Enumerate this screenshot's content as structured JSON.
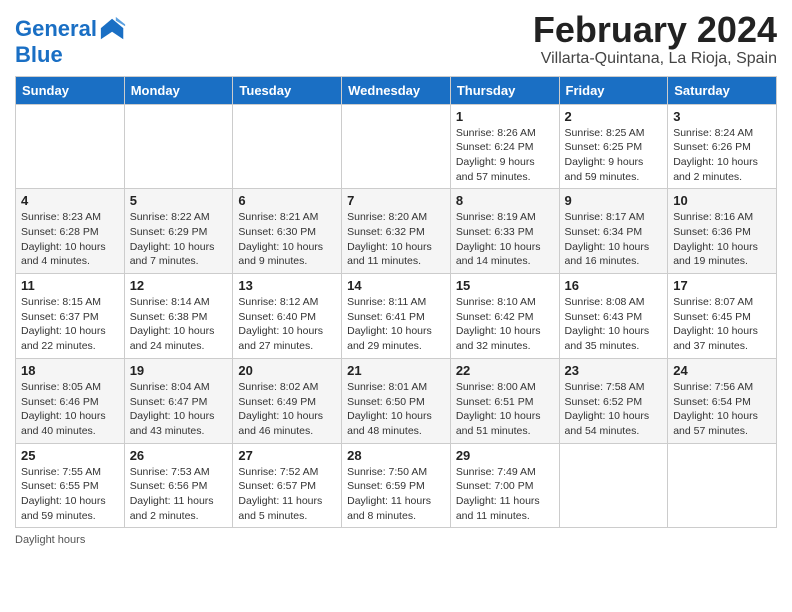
{
  "header": {
    "logo_line1": "General",
    "logo_line2": "Blue",
    "month": "February 2024",
    "location": "Villarta-Quintana, La Rioja, Spain"
  },
  "days_of_week": [
    "Sunday",
    "Monday",
    "Tuesday",
    "Wednesday",
    "Thursday",
    "Friday",
    "Saturday"
  ],
  "weeks": [
    [
      {
        "day": "",
        "info": ""
      },
      {
        "day": "",
        "info": ""
      },
      {
        "day": "",
        "info": ""
      },
      {
        "day": "",
        "info": ""
      },
      {
        "day": "1",
        "info": "Sunrise: 8:26 AM\nSunset: 6:24 PM\nDaylight: 9 hours and 57 minutes."
      },
      {
        "day": "2",
        "info": "Sunrise: 8:25 AM\nSunset: 6:25 PM\nDaylight: 9 hours and 59 minutes."
      },
      {
        "day": "3",
        "info": "Sunrise: 8:24 AM\nSunset: 6:26 PM\nDaylight: 10 hours and 2 minutes."
      }
    ],
    [
      {
        "day": "4",
        "info": "Sunrise: 8:23 AM\nSunset: 6:28 PM\nDaylight: 10 hours and 4 minutes."
      },
      {
        "day": "5",
        "info": "Sunrise: 8:22 AM\nSunset: 6:29 PM\nDaylight: 10 hours and 7 minutes."
      },
      {
        "day": "6",
        "info": "Sunrise: 8:21 AM\nSunset: 6:30 PM\nDaylight: 10 hours and 9 minutes."
      },
      {
        "day": "7",
        "info": "Sunrise: 8:20 AM\nSunset: 6:32 PM\nDaylight: 10 hours and 11 minutes."
      },
      {
        "day": "8",
        "info": "Sunrise: 8:19 AM\nSunset: 6:33 PM\nDaylight: 10 hours and 14 minutes."
      },
      {
        "day": "9",
        "info": "Sunrise: 8:17 AM\nSunset: 6:34 PM\nDaylight: 10 hours and 16 minutes."
      },
      {
        "day": "10",
        "info": "Sunrise: 8:16 AM\nSunset: 6:36 PM\nDaylight: 10 hours and 19 minutes."
      }
    ],
    [
      {
        "day": "11",
        "info": "Sunrise: 8:15 AM\nSunset: 6:37 PM\nDaylight: 10 hours and 22 minutes."
      },
      {
        "day": "12",
        "info": "Sunrise: 8:14 AM\nSunset: 6:38 PM\nDaylight: 10 hours and 24 minutes."
      },
      {
        "day": "13",
        "info": "Sunrise: 8:12 AM\nSunset: 6:40 PM\nDaylight: 10 hours and 27 minutes."
      },
      {
        "day": "14",
        "info": "Sunrise: 8:11 AM\nSunset: 6:41 PM\nDaylight: 10 hours and 29 minutes."
      },
      {
        "day": "15",
        "info": "Sunrise: 8:10 AM\nSunset: 6:42 PM\nDaylight: 10 hours and 32 minutes."
      },
      {
        "day": "16",
        "info": "Sunrise: 8:08 AM\nSunset: 6:43 PM\nDaylight: 10 hours and 35 minutes."
      },
      {
        "day": "17",
        "info": "Sunrise: 8:07 AM\nSunset: 6:45 PM\nDaylight: 10 hours and 37 minutes."
      }
    ],
    [
      {
        "day": "18",
        "info": "Sunrise: 8:05 AM\nSunset: 6:46 PM\nDaylight: 10 hours and 40 minutes."
      },
      {
        "day": "19",
        "info": "Sunrise: 8:04 AM\nSunset: 6:47 PM\nDaylight: 10 hours and 43 minutes."
      },
      {
        "day": "20",
        "info": "Sunrise: 8:02 AM\nSunset: 6:49 PM\nDaylight: 10 hours and 46 minutes."
      },
      {
        "day": "21",
        "info": "Sunrise: 8:01 AM\nSunset: 6:50 PM\nDaylight: 10 hours and 48 minutes."
      },
      {
        "day": "22",
        "info": "Sunrise: 8:00 AM\nSunset: 6:51 PM\nDaylight: 10 hours and 51 minutes."
      },
      {
        "day": "23",
        "info": "Sunrise: 7:58 AM\nSunset: 6:52 PM\nDaylight: 10 hours and 54 minutes."
      },
      {
        "day": "24",
        "info": "Sunrise: 7:56 AM\nSunset: 6:54 PM\nDaylight: 10 hours and 57 minutes."
      }
    ],
    [
      {
        "day": "25",
        "info": "Sunrise: 7:55 AM\nSunset: 6:55 PM\nDaylight: 10 hours and 59 minutes."
      },
      {
        "day": "26",
        "info": "Sunrise: 7:53 AM\nSunset: 6:56 PM\nDaylight: 11 hours and 2 minutes."
      },
      {
        "day": "27",
        "info": "Sunrise: 7:52 AM\nSunset: 6:57 PM\nDaylight: 11 hours and 5 minutes."
      },
      {
        "day": "28",
        "info": "Sunrise: 7:50 AM\nSunset: 6:59 PM\nDaylight: 11 hours and 8 minutes."
      },
      {
        "day": "29",
        "info": "Sunrise: 7:49 AM\nSunset: 7:00 PM\nDaylight: 11 hours and 11 minutes."
      },
      {
        "day": "",
        "info": ""
      },
      {
        "day": "",
        "info": ""
      }
    ]
  ],
  "footer": {
    "note": "Daylight hours"
  }
}
